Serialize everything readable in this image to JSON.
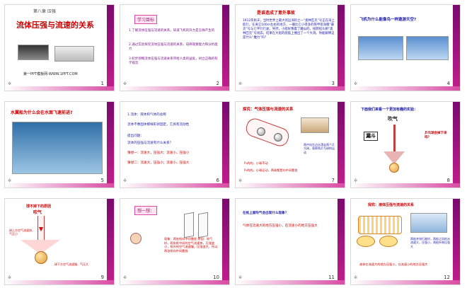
{
  "slides": [
    {
      "number": "1",
      "chapter": "第八章 压强",
      "title": "流体压强与流速的关系",
      "footer": "第一PPT模板网-WWW.1PPT.COM"
    },
    {
      "number": "2",
      "heading": "学习目标",
      "items": [
        "1.了解流体压强与流速的关系，知道飞机的升力是怎样产生的",
        "2.通过实验探究流体压强与流速的关系，培养观察能力和分析能力",
        "3.初步领略流体压强与流速关系带给人类的益处，树立正确的科学观念"
      ]
    },
    {
      "number": "3",
      "heading": "是谁造成了意外事故",
      "body": "1912年秋天，当时世界上最大的远洋轮之一“奥林匹克”号正在海上航行，在离它100m左右的地方，一艘比它小得多的铁甲巡洋舰“豪克”号与它平行行驶。突然，小船好像着了魔似的，扭转船头朝“奥林匹克”号闯去，结果在大船的船舷上撞出了一个大洞。你能解释这是什么“魔力”吗？"
    },
    {
      "number": "4",
      "heading": "飞机为什么能像鸟一样遨游天空?"
    },
    {
      "number": "5",
      "heading": "水翼船为什么会在水面飞速前进?"
    },
    {
      "number": "6",
      "lines": [
        "1.流体：液体和气体的总称",
        "流体不像固体那样形状固定，它具有流动性",
        "提出问题：",
        "流体的压强与流速有什么关系？",
        "猜想一：流速大，压强大；流速小，压强小",
        "猜想二：流速大，压强小；流速小，压强大"
      ]
    },
    {
      "number": "7",
      "heading": "探究：气体压强与流速的关系",
      "labels": [
        "P₁的的，小球不动",
        "P₂的的，小球运动，两球都是向中间靠拢"
      ],
      "note": "两中向左边水漂走两个乒乓球，观察两乒乓球的运动"
    },
    {
      "number": "8",
      "heading": "下面我们来看一个更加有趣的实验：",
      "blow": "吹气",
      "funnel": "漏斗",
      "side": "乒乓球会掉下来吗？"
    },
    {
      "number": "9",
      "heading": "球不掉下的原因",
      "blow": "吹气",
      "top_note": "球上方空气流速快，气压小",
      "bottom_note": "球下方空气流速慢，气压大"
    },
    {
      "number": "10",
      "heading": "想一想：",
      "body": "现象：两张纸向中间靠拢 原因：吹气时，两张纸中间的空气流速快，压强变小，纸外的空气流速慢，压强变大，所以两张纸向中间靠拢"
    },
    {
      "number": "11",
      "heading": "在纸上面吹气会出现什么现象？",
      "conclusion": "气体在流速大的地方压强小，在流速小的地方压强大"
    },
    {
      "number": "12",
      "heading": "探究：液体压强与流速的关系",
      "side": "两船并排行驶时，两船之间的水流速大，压强小，两船外侧压强大",
      "conclusion": "液体在流速大的地方压强小，在流速小的地方压强大"
    }
  ]
}
